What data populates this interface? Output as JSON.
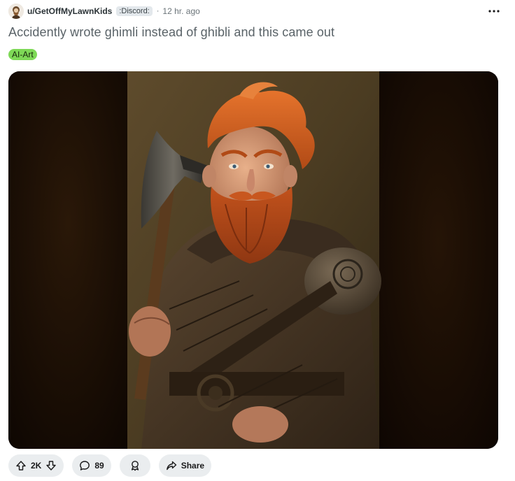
{
  "post": {
    "author": "u/GetOffMyLawnKids",
    "flair": ":Discord:",
    "separator": "·",
    "time": "12 hr. ago",
    "title": "Accidently wrote ghimli instead of ghibli and this came out",
    "tag": "AI-Art",
    "tag_color": "#7ed957"
  },
  "media": {
    "kind": "image",
    "subject": "oil-painting style portrait of a red-bearded dwarf holding an axe, wearing leather armor"
  },
  "actions": {
    "upvotes": "2K",
    "comments": "89",
    "share_label": "Share"
  },
  "icons": {
    "more": "more-options-icon",
    "upvote": "upvote-arrow-icon",
    "downvote": "downvote-arrow-icon",
    "comment": "comment-bubble-icon",
    "award": "award-icon",
    "share": "share-arrow-icon"
  }
}
